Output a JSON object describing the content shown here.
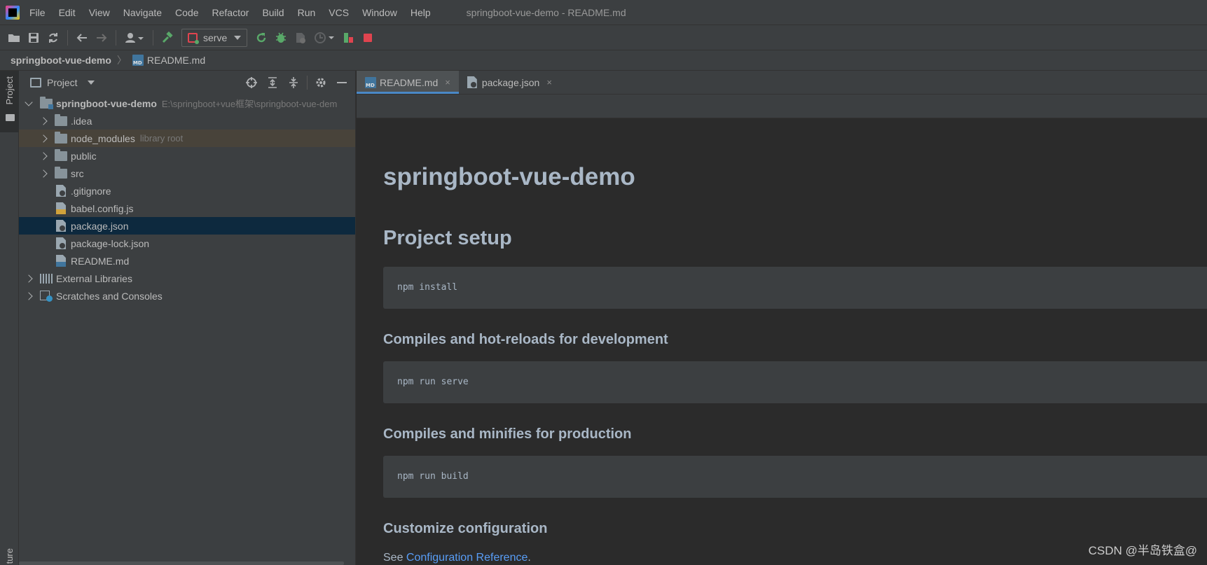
{
  "window": {
    "title": "springboot-vue-demo - README.md",
    "menu": [
      "File",
      "Edit",
      "View",
      "Navigate",
      "Code",
      "Refactor",
      "Build",
      "Run",
      "VCS",
      "Window",
      "Help"
    ]
  },
  "toolbar": {
    "run_config": "serve"
  },
  "breadcrumb": {
    "project": "springboot-vue-demo",
    "file": "README.md"
  },
  "left_stripe": {
    "project_label": "Project",
    "structure_label": "ture"
  },
  "project_panel": {
    "title": "Project",
    "root": {
      "name": "springboot-vue-demo",
      "path": "E:\\springboot+vue框架\\springboot-vue-dem"
    },
    "items": [
      {
        "label": ".idea",
        "hint": ""
      },
      {
        "label": "node_modules",
        "hint": "library root"
      },
      {
        "label": "public",
        "hint": ""
      },
      {
        "label": "src",
        "hint": ""
      },
      {
        "label": ".gitignore",
        "hint": ""
      },
      {
        "label": "babel.config.js",
        "hint": ""
      },
      {
        "label": "package.json",
        "hint": ""
      },
      {
        "label": "package-lock.json",
        "hint": ""
      },
      {
        "label": "README.md",
        "hint": ""
      },
      {
        "label": "External Libraries",
        "hint": ""
      },
      {
        "label": "Scratches and Consoles",
        "hint": ""
      }
    ]
  },
  "editor": {
    "tabs": [
      {
        "label": "README.md",
        "close": "×"
      },
      {
        "label": "package.json",
        "close": "×"
      }
    ],
    "preview": {
      "h1": "springboot-vue-demo",
      "h2": "Project setup",
      "block1": "npm install",
      "h3_dev": "Compiles and hot-reloads for development",
      "block2": "npm run serve",
      "h3_prod": "Compiles and minifies for production",
      "block3": "npm run build",
      "h3_config": "Customize configuration",
      "see_text": "See ",
      "link_text": "Configuration Reference",
      "link_suffix": "."
    }
  },
  "watermark": "CSDN @半岛铁盒@",
  "colors": {
    "accent": "#4a88c7",
    "selection": "#0d293e",
    "library_row": "#48433a",
    "link": "#589df6",
    "run_green": "#59a869",
    "stop_red": "#e0444f"
  }
}
